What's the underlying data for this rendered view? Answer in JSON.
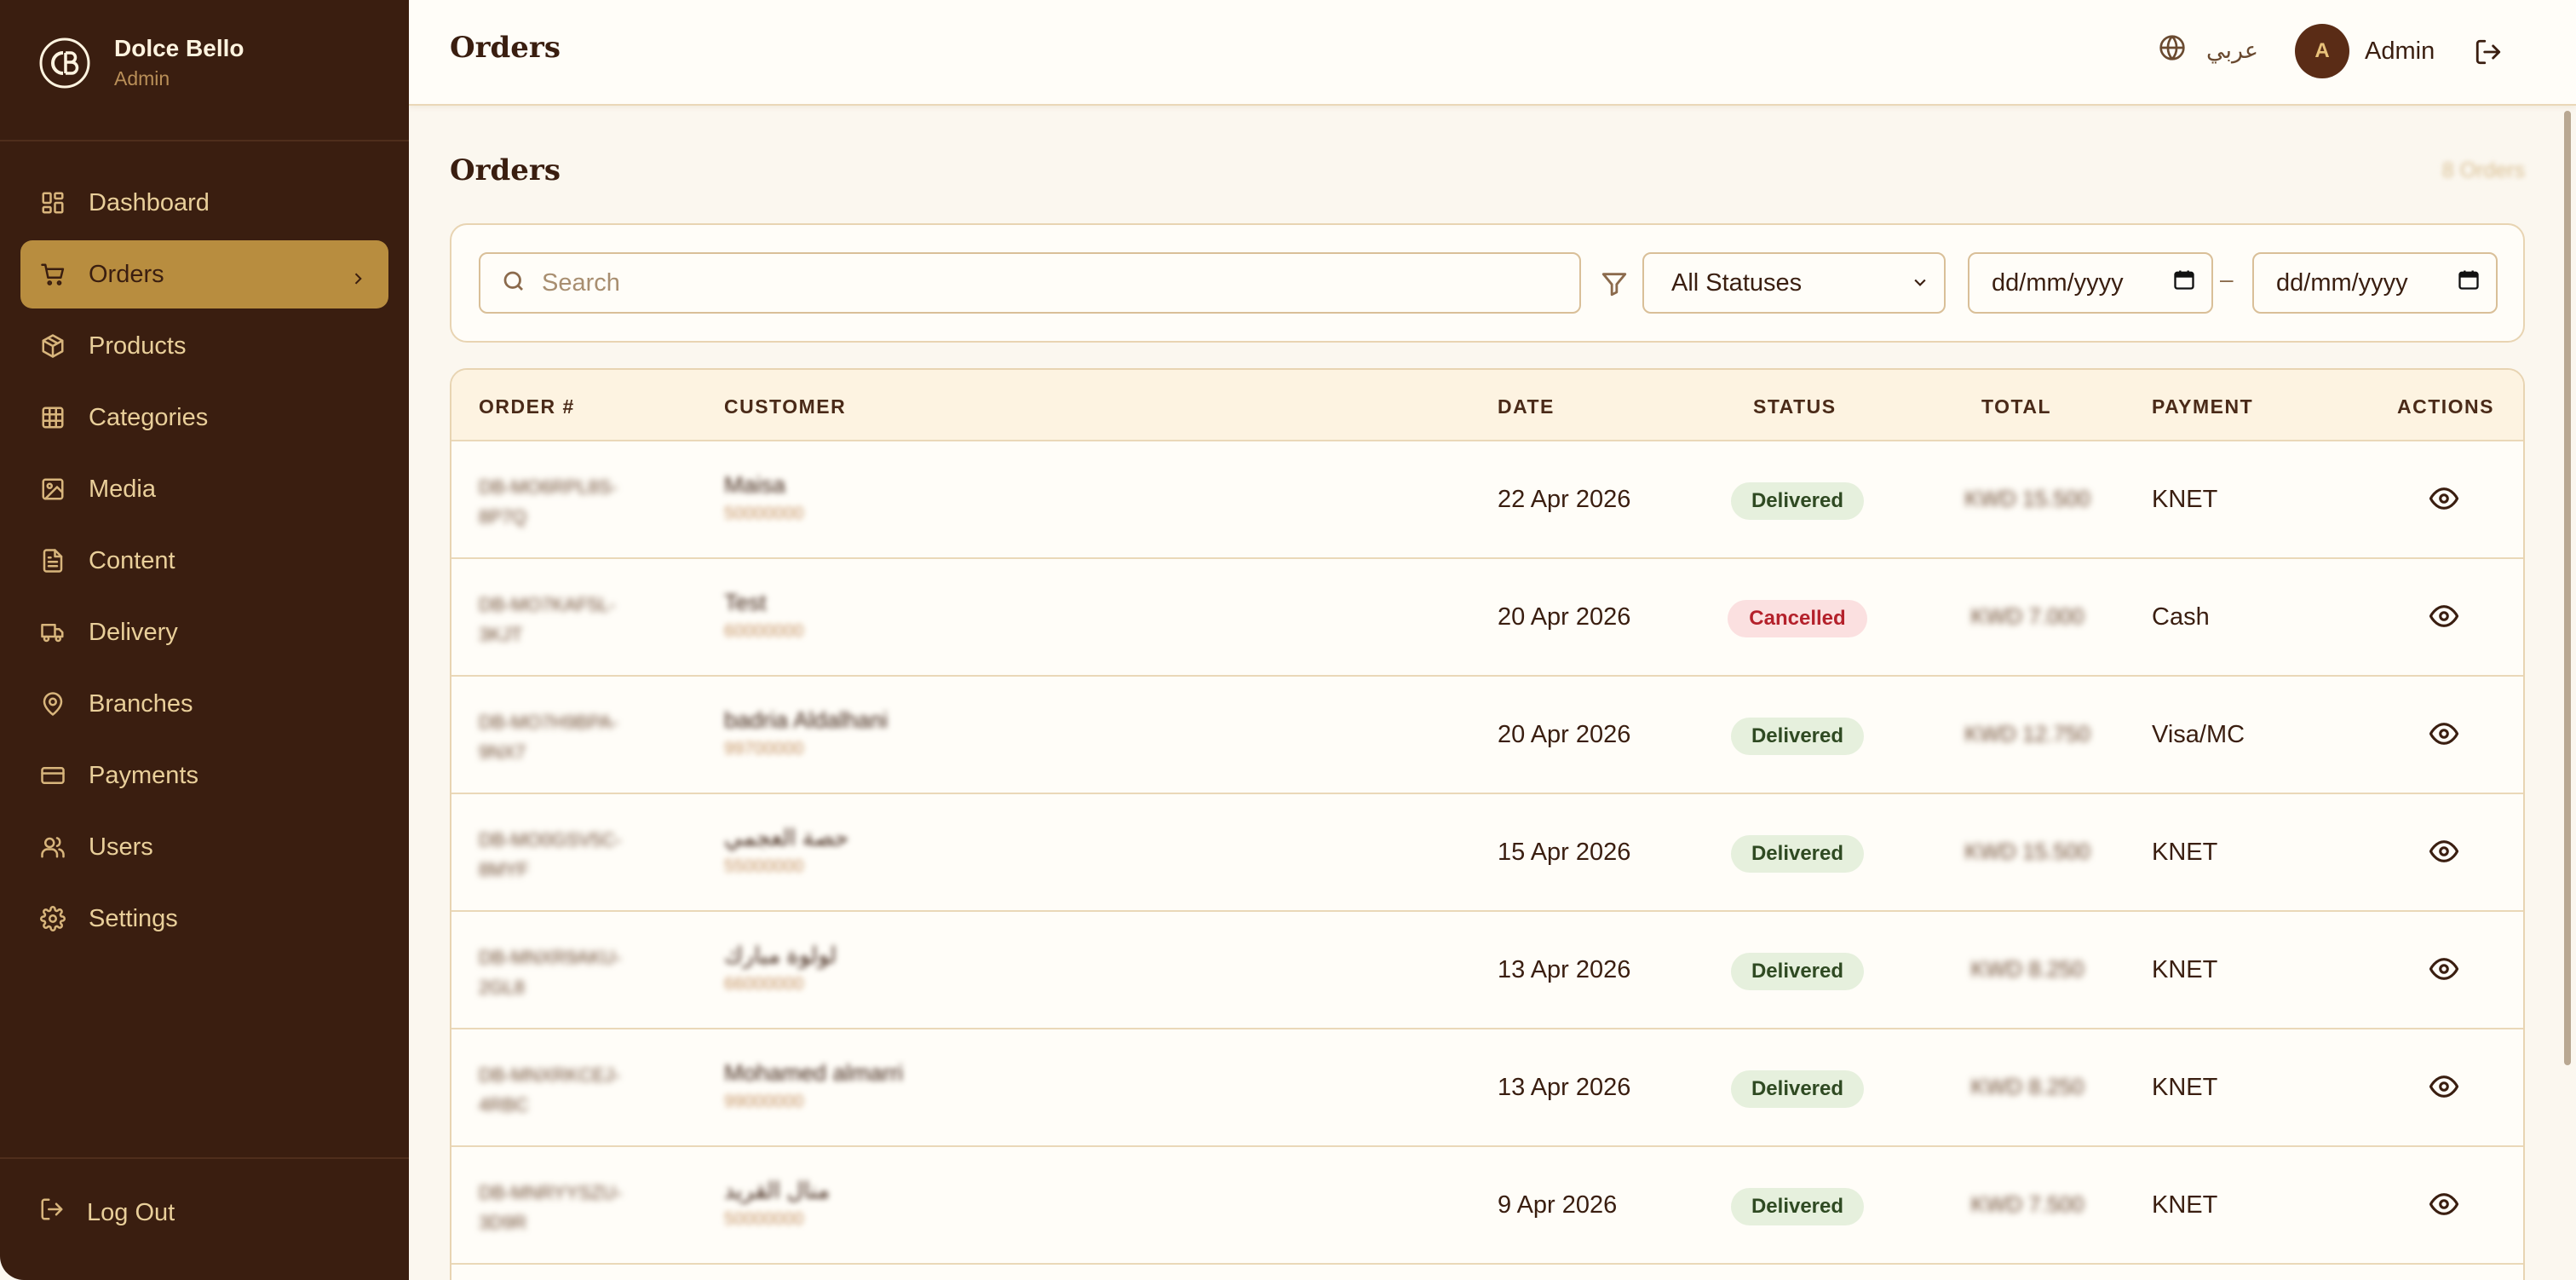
{
  "brand": {
    "name": "Dolce Bello",
    "role": "Admin"
  },
  "sidebar": {
    "items": [
      {
        "label": "Dashboard",
        "icon": "dashboard-icon"
      },
      {
        "label": "Orders",
        "icon": "cart-icon",
        "active": true
      },
      {
        "label": "Products",
        "icon": "box-icon"
      },
      {
        "label": "Categories",
        "icon": "grid-icon"
      },
      {
        "label": "Media",
        "icon": "image-icon"
      },
      {
        "label": "Content",
        "icon": "document-icon"
      },
      {
        "label": "Delivery",
        "icon": "truck-icon"
      },
      {
        "label": "Branches",
        "icon": "map-pin-icon"
      },
      {
        "label": "Payments",
        "icon": "credit-card-icon"
      },
      {
        "label": "Users",
        "icon": "users-icon"
      },
      {
        "label": "Settings",
        "icon": "gear-icon"
      }
    ],
    "logout_label": "Log Out"
  },
  "header": {
    "title": "Orders",
    "language_label": "عربي",
    "avatar_initial": "A",
    "user_name": "Admin"
  },
  "main": {
    "title": "Orders",
    "count_label": "8 Orders",
    "filters": {
      "search_placeholder": "Search",
      "status_selected": "All Statuses",
      "date_from_placeholder": "dd/mm/yyyy",
      "date_separator": "–",
      "date_to_placeholder": "dd/mm/yyyy"
    },
    "table": {
      "columns": [
        "ORDER #",
        "CUSTOMER",
        "DATE",
        "STATUS",
        "TOTAL",
        "PAYMENT",
        "ACTIONS"
      ],
      "rows": [
        {
          "order": "DB-MO6RPL8S-8P7Q",
          "customer": "Maisa",
          "phone": "50000000",
          "date": "22 Apr 2026",
          "status": "Delivered",
          "status_kind": "delivered",
          "total": "KWD 15.500",
          "payment": "KNET"
        },
        {
          "order": "DB-MO7KAF5L-3KJT",
          "customer": "Test",
          "phone": "60000000",
          "date": "20 Apr 2026",
          "status": "Cancelled",
          "status_kind": "cancelled",
          "total": "KWD 7.000",
          "payment": "Cash"
        },
        {
          "order": "DB-MO7H9BPA-9NX7",
          "customer": "badria Aldalhani",
          "phone": "99700000",
          "date": "20 Apr 2026",
          "status": "Delivered",
          "status_kind": "delivered",
          "total": "KWD 12.750",
          "payment": "Visa/MC"
        },
        {
          "order": "DB-MO0GSV5C-8MYF",
          "customer": "حصة العجمي",
          "phone": "55000000",
          "date": "15 Apr 2026",
          "status": "Delivered",
          "status_kind": "delivered",
          "total": "KWD 15.500",
          "payment": "KNET"
        },
        {
          "order": "DB-MNXR9AKU-2GL8",
          "customer": "لولوة مبارك",
          "phone": "66000000",
          "date": "13 Apr 2026",
          "status": "Delivered",
          "status_kind": "delivered",
          "total": "KWD 8.250",
          "payment": "KNET"
        },
        {
          "order": "DB-MNXRKCEJ-4RBC",
          "customer": "Mohamed almarri",
          "phone": "99000000",
          "date": "13 Apr 2026",
          "status": "Delivered",
          "status_kind": "delivered",
          "total": "KWD 8.250",
          "payment": "KNET"
        },
        {
          "order": "DB-MNRYYSZU-3D9R",
          "customer": "منال القريد",
          "phone": "50000000",
          "date": "9 Apr 2026",
          "status": "Delivered",
          "status_kind": "delivered",
          "total": "KWD 7.500",
          "payment": "KNET"
        }
      ]
    }
  },
  "colors": {
    "sidebar_bg": "#3a1e10",
    "accent": "#b88d3f",
    "page_bg": "#fbf7ef",
    "delivered_bg": "#e6f0dd",
    "cancelled_bg": "#fbe0e0",
    "cancelled_text": "#b4212b"
  }
}
